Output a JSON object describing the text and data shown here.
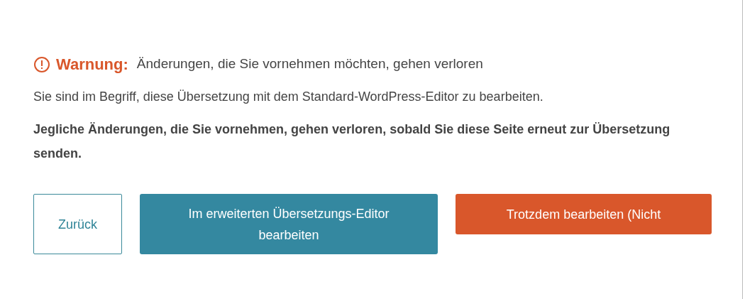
{
  "warning": {
    "label": "Warnung:",
    "message": "Änderungen, die Sie vornehmen möchten, gehen verloren"
  },
  "paragraphs": [
    {
      "text": "Sie sind im Begriff, diese Übersetzung mit dem Standard-WordPress-Editor zu bearbeiten.",
      "bold": false
    },
    {
      "text": "Jegliche Änderungen, die Sie vornehmen, gehen verloren, sobald Sie diese Seite erneut zur Übersetzung senden.",
      "bold": true
    }
  ],
  "buttons": [
    {
      "label": "Zurück",
      "kind": "outline"
    },
    {
      "label": "Im erweiterten Übersetzungs-Editor bearbeiten",
      "kind": "primary"
    },
    {
      "label": "Trotzdem bearbeiten (Nicht",
      "kind": "danger"
    }
  ]
}
